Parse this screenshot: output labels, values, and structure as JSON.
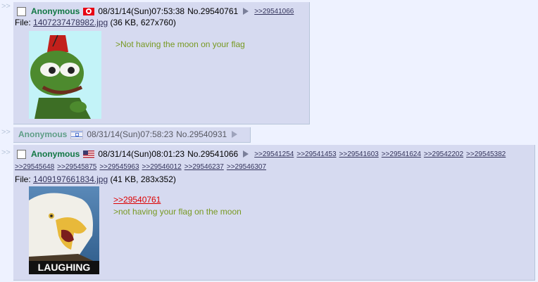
{
  "posts": [
    {
      "name": "Anonymous",
      "flag": "tunisia-flag-icon",
      "datetime": "08/31/14(Sun)07:53:38",
      "number": "No.29540761",
      "backlinks": [
        ">>29541066"
      ],
      "file": {
        "label": "File:",
        "filename": "1407237478982.jpg",
        "meta": "(36 KB, 627x760)"
      },
      "message": [
        ">Not having the moon on your flag"
      ]
    },
    {
      "name": "Anonymous",
      "flag": "israel-flag-icon",
      "datetime": "08/31/14(Sun)07:58:23",
      "number": "No.29540931"
    },
    {
      "name": "Anonymous",
      "flag": "us-flag-icon",
      "datetime": "08/31/14(Sun)08:01:23",
      "number": "No.29541066",
      "backlinks": [
        ">>29541254",
        ">>29541453",
        ">>29541603",
        ">>29541624",
        ">>29542202",
        ">>29545382",
        ">>29545648",
        ">>29545875",
        ">>29545963",
        ">>29546012",
        ">>29546237",
        ">>29546307"
      ],
      "file": {
        "label": "File:",
        "filename": "1409197661834.jpg",
        "meta": "(41 KB, 283x352)",
        "thumb_caption": "LAUGHING"
      },
      "message": [
        ">>29540761",
        ">not having your flag on the moon"
      ]
    }
  ],
  "side_arrows": ">>",
  "colors": {
    "name": "#117743",
    "greentext": "#789922",
    "quotelink": "#dd0000",
    "post_bg": "#d6daf0",
    "page_bg": "#eef2ff"
  }
}
